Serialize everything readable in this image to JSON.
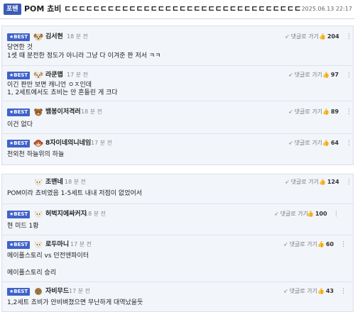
{
  "post": {
    "category": "포텐",
    "title": "POM 쵸비 ㄷㄷㄷㄷㄷㄷㄷㄷㄷㄷㄷㄷㄷㄷㄷㄷㄷㄷㄷㄷㄷㄷㄷㄷㄷㄷㄷㄷㄷㄷㄷㄷㄷㄷㄷㄷ",
    "date": "2025.06.13 22:17"
  },
  "labels": {
    "best": "★BEST",
    "reply": "댓글로 가기",
    "reply_arrow": "➶",
    "thumb": "👍",
    "menu": "⋮"
  },
  "comments": [
    {
      "nick": "김서현",
      "time": "18 분 전",
      "likes": "204",
      "avatar_icon": "dog-avatar-icon",
      "lines": [
        "당연한 것",
        "1셋 때 분전한 정도가 아니라 그냥 다 이겨준 판 저서 ㅋㅋ"
      ]
    },
    {
      "nick": "라쿤맵",
      "time": "17 분 전",
      "likes": "97",
      "avatar_icon": "dog-avatar-icon",
      "lines": [
        "이긴 판만 보면 캐니언 ㅇㅈ인데",
        "1, 2세트에서도 쵸비는 안 흔들린 게 크다"
      ]
    },
    {
      "nick": "뱀봉이저격러",
      "time": "18 분 전",
      "likes": "89",
      "avatar_icon": "bear-avatar-icon",
      "lines": [
        "이건 없다"
      ]
    },
    {
      "nick": "8자이네의니네임",
      "time": "17 분 전",
      "likes": "64",
      "avatar_icon": "monkey-avatar-icon",
      "lines": [
        "천외천 하늘위의 하늘"
      ]
    },
    {
      "nick": "조맨네",
      "time": "18 분 전",
      "likes": "124",
      "avatar_icon": "cat-avatar-icon",
      "lines": [
        "POM이라 쵸비였음 1-5세트 내내 저점이 없었어서"
      ]
    },
    {
      "nick": "허벅지에싸커지",
      "time": "18 분 전",
      "likes": "100",
      "avatar_icon": "cat-avatar-icon",
      "lines": [
        "현 미드 1황"
      ]
    },
    {
      "nick": "로두마니",
      "time": "17 분 전",
      "likes": "60",
      "avatar_icon": "cat-avatar-icon",
      "lines": [
        "메이플스토리 vs 던전앤파이터",
        "",
        "메이플스토리 승리"
      ]
    },
    {
      "nick": "자비무드",
      "time": "17 분 전",
      "likes": "43",
      "avatar_icon": "cookie-avatar-icon",
      "lines": [
        "1,2세트 쵸비가 안비벼쳤으면 무난하게 대역났을듯"
      ]
    }
  ],
  "colors": {
    "accent": "#3b5bb5",
    "best_badge": "#3f62c9",
    "list_bg": "#f2f5fa"
  }
}
